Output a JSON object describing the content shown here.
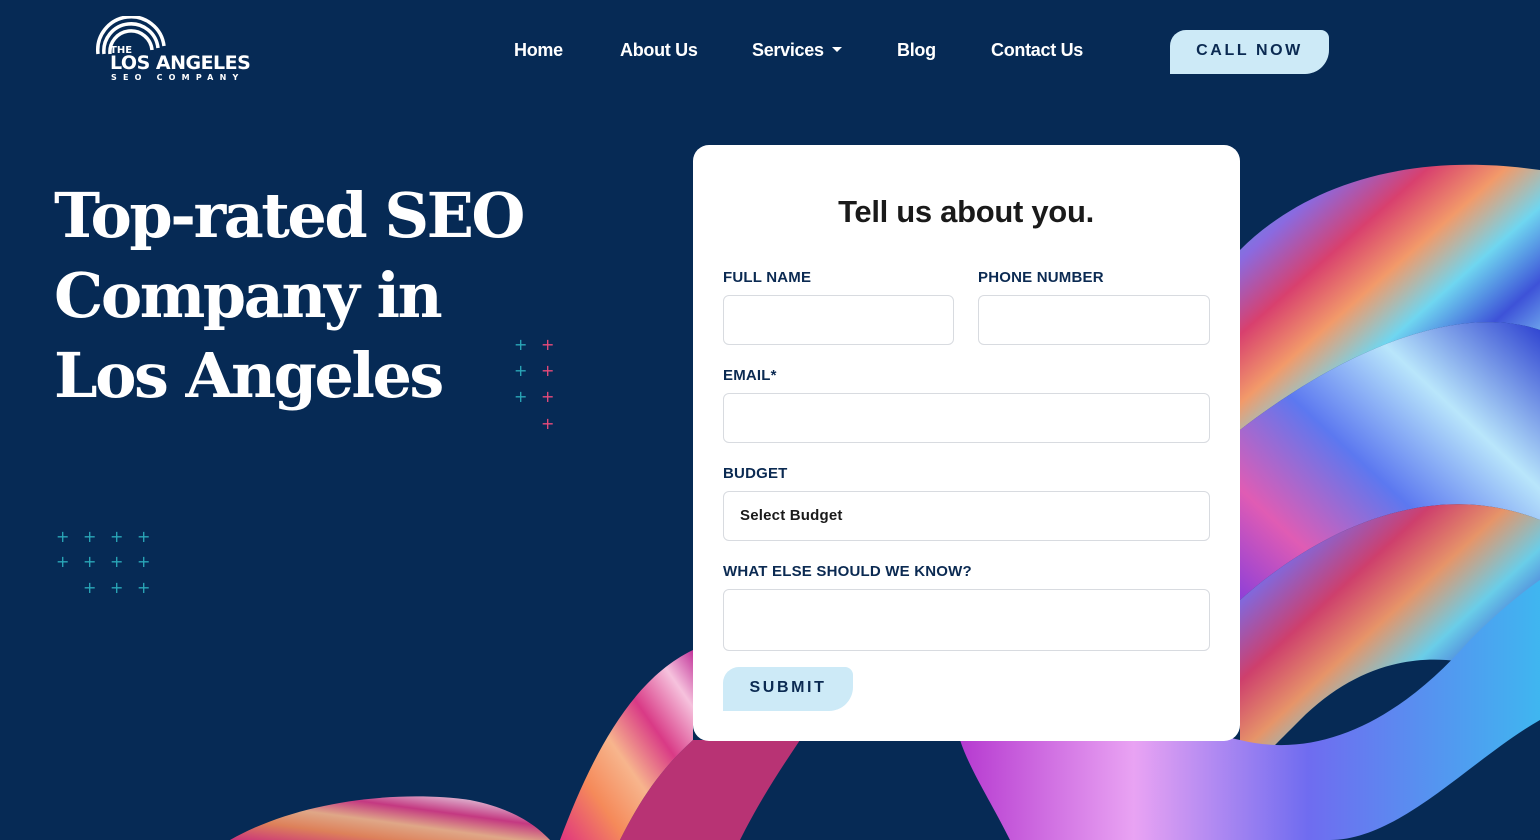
{
  "logo": {
    "the": "THE",
    "main": "LOS ANGELES",
    "sub": "SEO COMPANY"
  },
  "nav": {
    "items": [
      {
        "label": "Home"
      },
      {
        "label": "About Us"
      },
      {
        "label": "Services"
      },
      {
        "label": "Blog"
      },
      {
        "label": "Contact Us"
      }
    ],
    "cta": "CALL NOW"
  },
  "hero": {
    "line1": "Top-rated SEO",
    "line2": "Company in",
    "line3": "Los Angeles"
  },
  "form": {
    "title": "Tell us about you.",
    "full_name_label": "FULL NAME",
    "full_name_value": "",
    "phone_label": "PHONE NUMBER",
    "phone_value": "",
    "email_label": "EMAIL*",
    "email_value": "",
    "budget_label": "BUDGET",
    "budget_selected": "Select Budget",
    "message_label": "WHAT ELSE SHOULD WE KNOW?",
    "message_value": "",
    "submit_label": "SUBMIT"
  },
  "colors": {
    "background": "#062a55",
    "button_bg": "#cdeaf7",
    "button_text": "#0b2a52",
    "plus_teal": "#2aa7b8",
    "plus_pink": "#e84a7a",
    "card_bg": "#ffffff"
  },
  "icons": {
    "services_caret": "caret-down-icon",
    "logo_mark": "signal-arcs-icon"
  }
}
